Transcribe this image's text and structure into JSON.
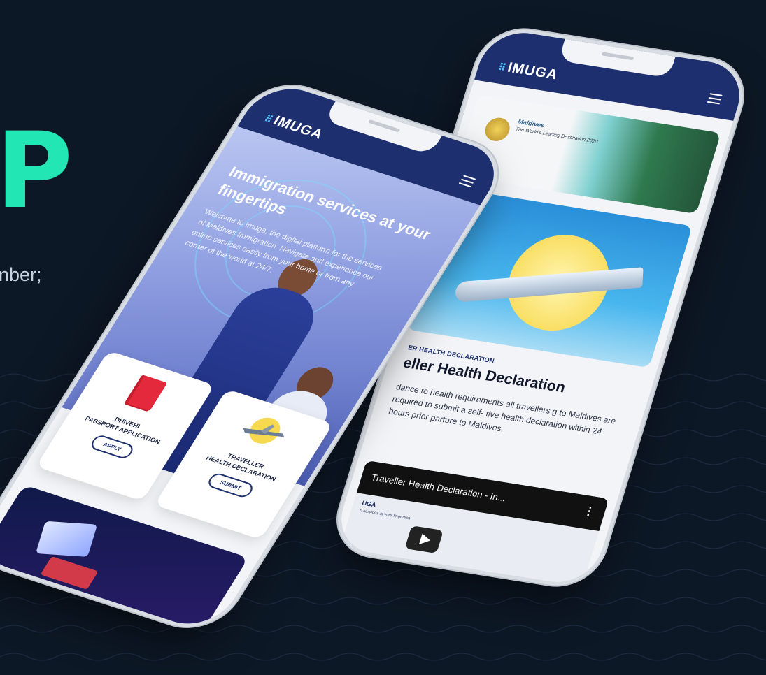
{
  "hero": {
    "letter": "P",
    "subtitle": "nber;"
  },
  "app": {
    "logo": "IMUGA"
  },
  "front_phone": {
    "hero_title": "Immigration services at your fingertips",
    "hero_text": "Welcome to Imuga, the digital platform for the services of Maldives Immigration. Navigate and experience our online services easily from your home or from any corner of the world at 24/7.",
    "cards": [
      {
        "label_line1": "DHIVEHI",
        "label_line2": "PASSPORT APPLICATION",
        "button": "APPLY"
      },
      {
        "label_line1": "TRAVELLER",
        "label_line2": "HEALTH DECLARATION",
        "button": "SUBMIT"
      }
    ]
  },
  "back_phone": {
    "banner_title": "Maldives",
    "banner_sub": "The World's Leading Destination 2020",
    "kicker": "ER HEALTH DECLARATION",
    "title": "eller Health Declaration",
    "text": "dance to health requirements all travellers g to Maldives are required to submit a self- tive health declaration within 24 hours prior parture to Maldives.",
    "video_title": "Traveller Health Declaration - In...",
    "video_logo": "UGA",
    "video_sub": "n services at your fingertips"
  },
  "colors": {
    "accent": "#22e6b3",
    "navy": "#1d2f6e",
    "background": "#0d1826"
  }
}
